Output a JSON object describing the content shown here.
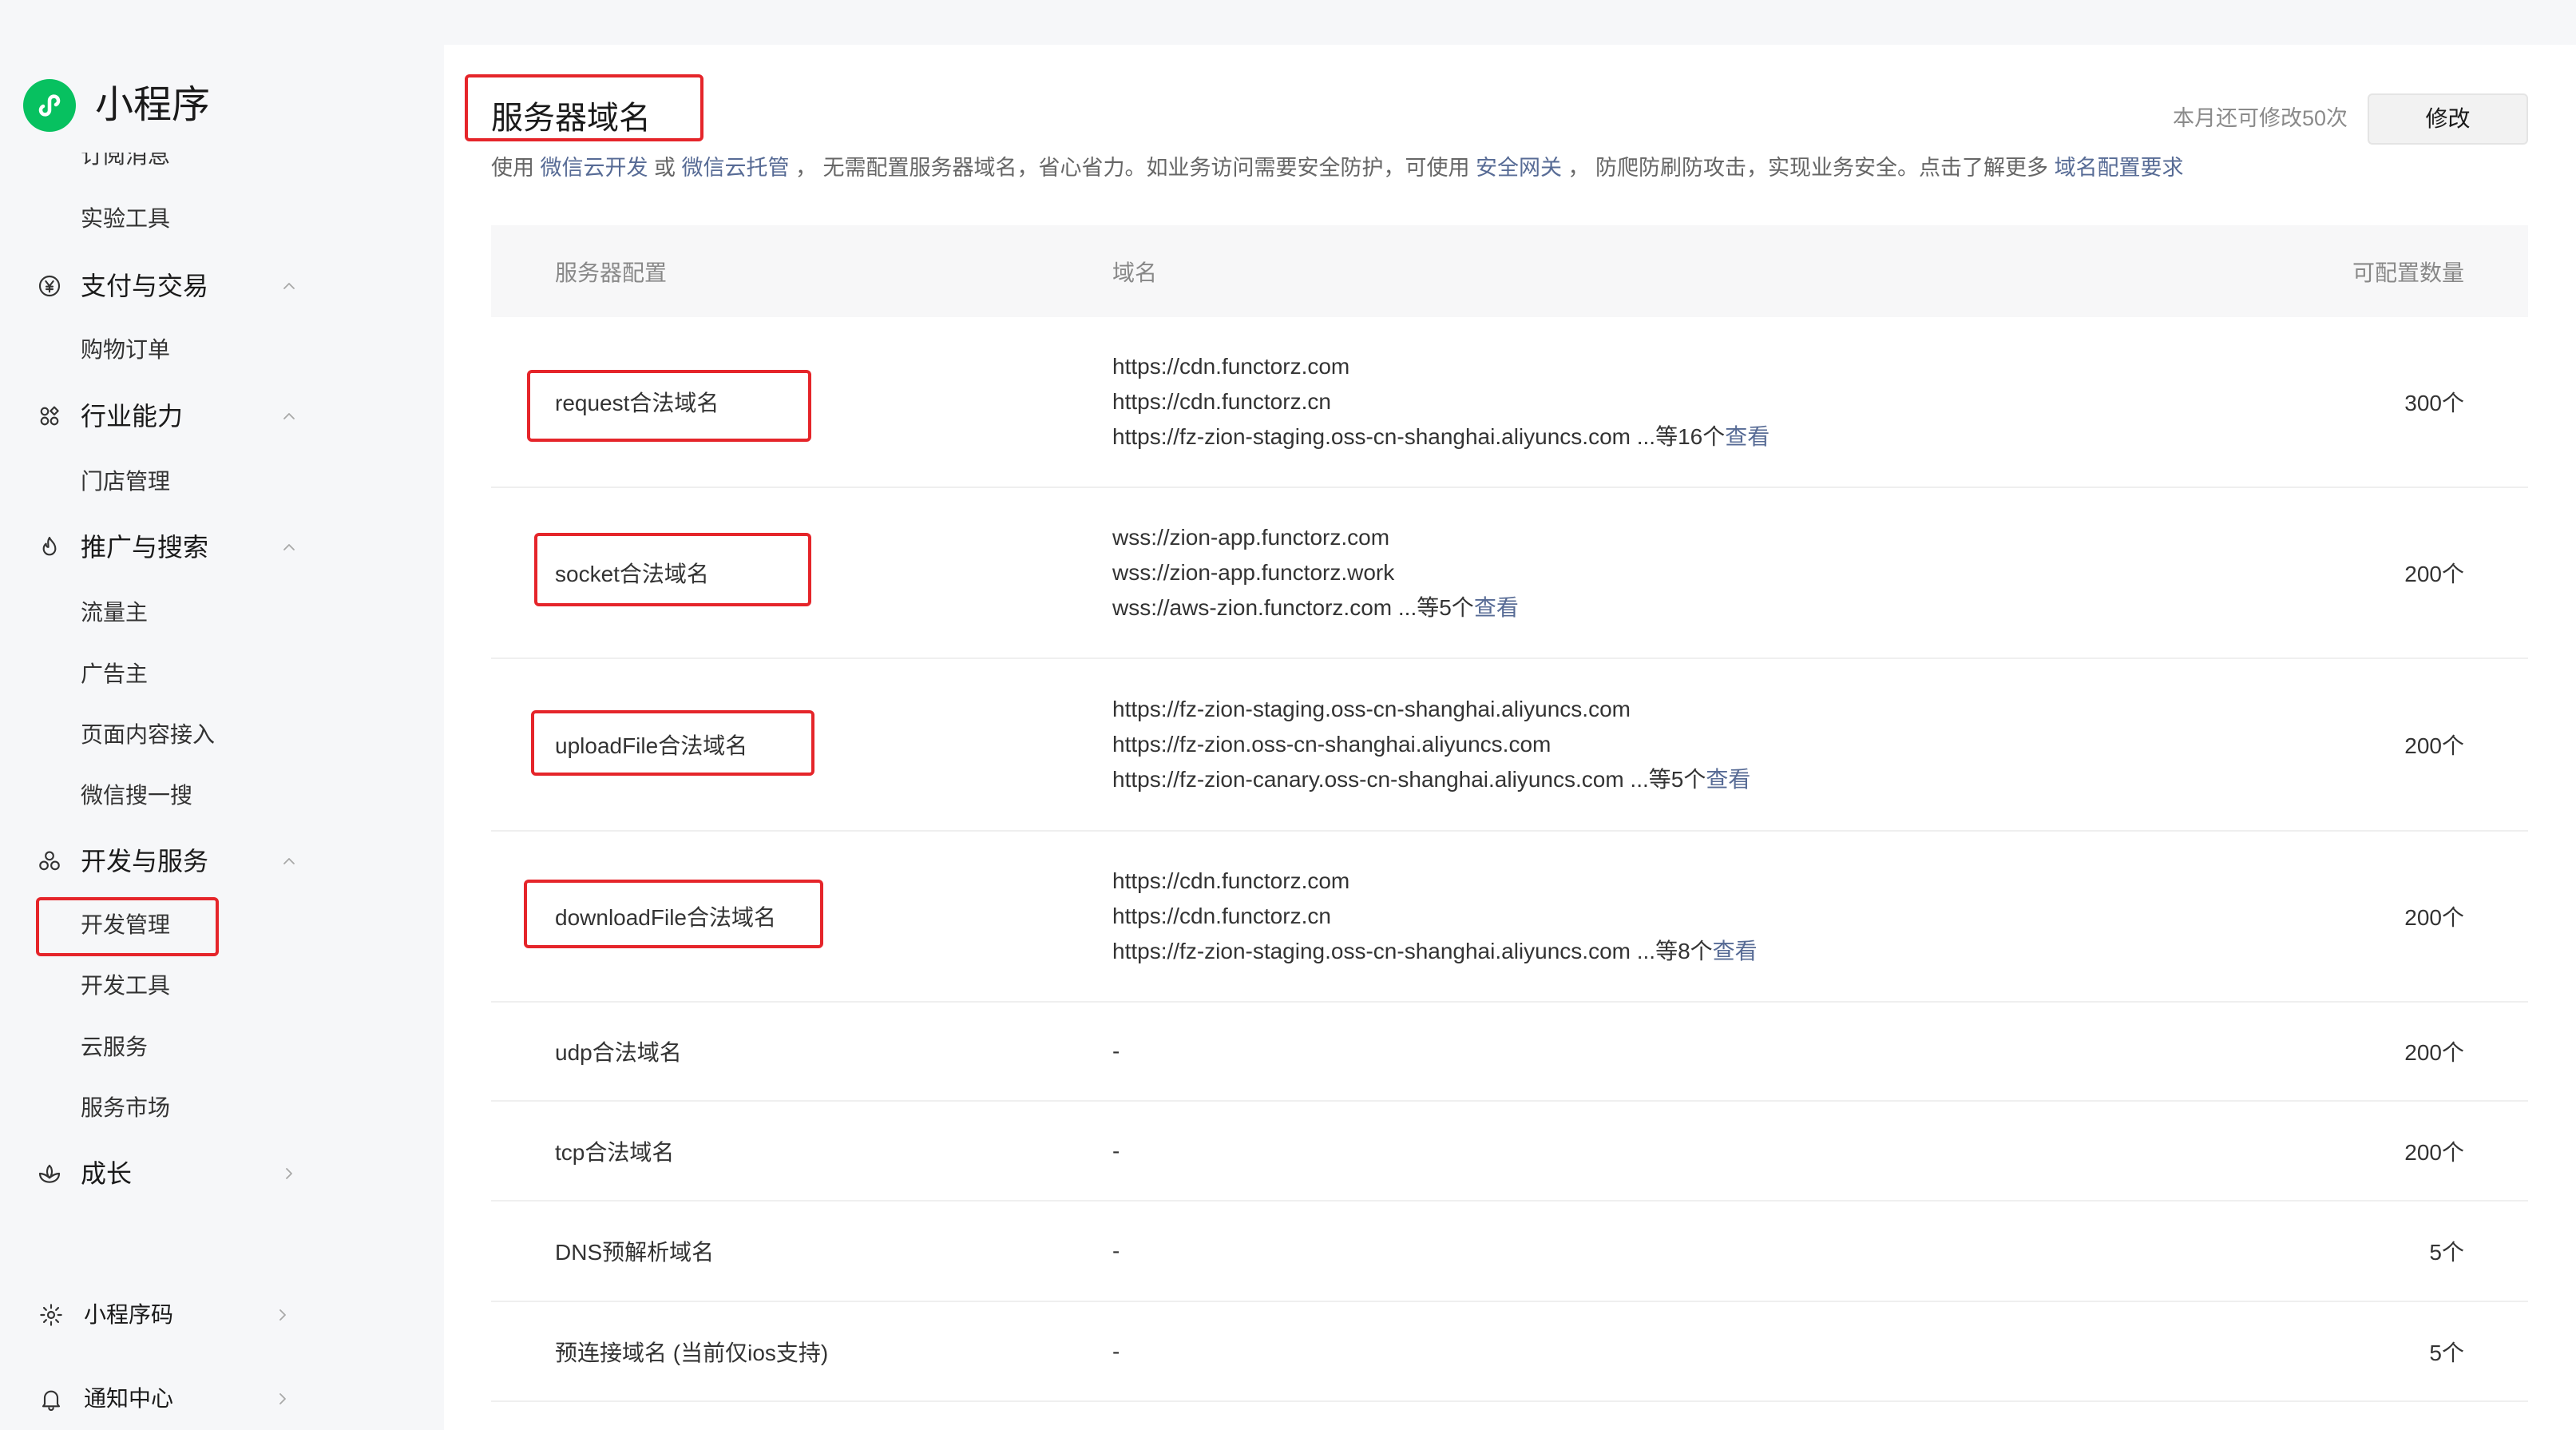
{
  "app": {
    "name": "小程序",
    "logo_icon": "mini-program-logo-icon"
  },
  "colors": {
    "brand_green": "#07c160",
    "link": "#576b95",
    "annotation_red": "#e5252a",
    "text": "#333333",
    "muted": "#888888"
  },
  "sidebar": {
    "nav": [
      {
        "label": "订阅消息"
      },
      {
        "label": "实验工具"
      },
      {
        "label": "支付与交易",
        "icon": "yen-circle-icon",
        "chevron": "chevron-up-icon"
      },
      {
        "label": "购物订单"
      },
      {
        "label": "行业能力",
        "icon": "industry-icon",
        "chevron": "chevron-up-icon"
      },
      {
        "label": "门店管理"
      },
      {
        "label": "推广与搜索",
        "icon": "flame-icon",
        "chevron": "chevron-up-icon"
      },
      {
        "label": "流量主"
      },
      {
        "label": "广告主"
      },
      {
        "label": "页面内容接入"
      },
      {
        "label": "微信搜一搜"
      },
      {
        "label": "开发与服务",
        "icon": "dev-services-icon",
        "chevron": "chevron-up-icon"
      },
      {
        "label": "开发管理",
        "highlighted": true
      },
      {
        "label": "开发工具"
      },
      {
        "label": "云服务"
      },
      {
        "label": "服务市场"
      },
      {
        "label": "成长",
        "icon": "growth-icon",
        "chevron": "chevron-right-icon"
      }
    ],
    "footer": [
      {
        "label": "小程序码",
        "icon": "mini-program-code-icon",
        "chevron": "chevron-right-icon"
      },
      {
        "label": "通知中心",
        "icon": "bell-icon",
        "chevron": "chevron-right-icon"
      }
    ]
  },
  "page": {
    "title": "服务器域名",
    "title_highlighted": true,
    "quota": "本月还可修改50次",
    "edit_button": "修改",
    "description": [
      {
        "text": "使用 "
      },
      {
        "text": "微信云开发",
        "link": true
      },
      {
        "text": " 或 "
      },
      {
        "text": "微信云托管",
        "link": true
      },
      {
        "text": " ， 无需配置服务器域名，省心省力。如业务访问需要安全防护，可使用 "
      },
      {
        "text": "安全网关",
        "link": true
      },
      {
        "text": " ， 防爬防刷防攻击，实现业务安全。点击了解更多 "
      },
      {
        "text": "域名配置要求",
        "link": true
      }
    ]
  },
  "table": {
    "headers": [
      "服务器配置",
      "域名",
      "可配置数量"
    ],
    "rows": [
      {
        "name": "request合法域名",
        "domains": [
          "https://cdn.functorz.com",
          "https://cdn.functorz.cn",
          "https://fz-zion-staging.oss-cn-shanghai.aliyuncs.com"
        ],
        "more": "...等16个",
        "view": "查看",
        "count": "300个",
        "highlighted": true
      },
      {
        "name": "socket合法域名",
        "domains": [
          "wss://zion-app.functorz.com",
          "wss://zion-app.functorz.work",
          "wss://aws-zion.functorz.com"
        ],
        "more": "...等5个",
        "view": "查看",
        "count": "200个",
        "highlighted": true
      },
      {
        "name": "uploadFile合法域名",
        "domains": [
          "https://fz-zion-staging.oss-cn-shanghai.aliyuncs.com",
          "https://fz-zion.oss-cn-shanghai.aliyuncs.com",
          "https://fz-zion-canary.oss-cn-shanghai.aliyuncs.com"
        ],
        "more": "...等5个",
        "view": "查看",
        "count": "200个",
        "highlighted": true
      },
      {
        "name": "downloadFile合法域名",
        "domains": [
          "https://cdn.functorz.com",
          "https://cdn.functorz.cn",
          "https://fz-zion-staging.oss-cn-shanghai.aliyuncs.com"
        ],
        "more": "...等8个",
        "view": "查看",
        "count": "200个",
        "highlighted": true
      },
      {
        "name": "udp合法域名",
        "domains": [
          "-"
        ],
        "count": "200个"
      },
      {
        "name": "tcp合法域名",
        "domains": [
          "-"
        ],
        "count": "200个"
      },
      {
        "name": "DNS预解析域名",
        "domains": [
          "-"
        ],
        "count": "5个"
      },
      {
        "name": "预连接域名 (当前仅ios支持)",
        "domains": [
          "-"
        ],
        "count": "5个"
      }
    ]
  }
}
